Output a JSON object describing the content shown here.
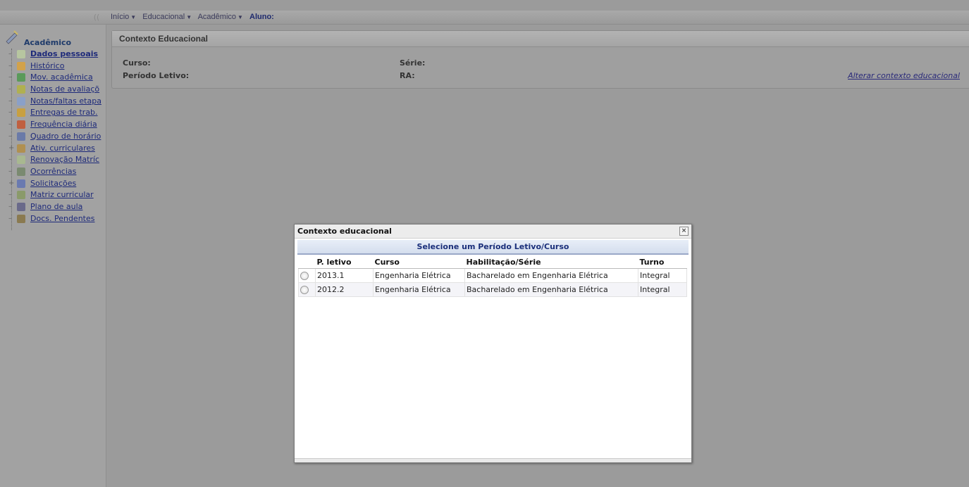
{
  "nav": {
    "collapse": "((",
    "crumbs": [
      {
        "label": "Início"
      },
      {
        "label": "Educacional"
      },
      {
        "label": "Acadêmico"
      }
    ],
    "aluno_label": "Aluno:"
  },
  "sidebar": {
    "title": "Acadêmico",
    "items": [
      {
        "label": "Dados pessoais",
        "icon": "bullet-icon",
        "color": "#b7c6a0"
      },
      {
        "label": "Histórico",
        "icon": "pencil-icon",
        "color": "#d2a24a"
      },
      {
        "label": "Mov. acadêmica",
        "icon": "arrows-icon",
        "color": "#5a9a5a"
      },
      {
        "label": "Notas de avaliaçõ",
        "icon": "bullet-icon",
        "color": "#b0b050"
      },
      {
        "label": "Notas/faltas etapa",
        "icon": "grid-icon",
        "color": "#8aa0c8"
      },
      {
        "label": "Entregas de trab.",
        "icon": "folder-icon",
        "color": "#c8a040"
      },
      {
        "label": "Frequência diária",
        "icon": "calendar-icon",
        "color": "#c06040"
      },
      {
        "label": "Quadro de horário",
        "icon": "clock-icon",
        "color": "#6a7aa8"
      },
      {
        "label": "Ativ. curriculares",
        "icon": "person-icon",
        "color": "#b09050"
      },
      {
        "label": "Renovação Matríc",
        "icon": "bullet-icon",
        "color": "#a8b890"
      },
      {
        "label": "Ocorrências",
        "icon": "pen-icon",
        "color": "#7a8a70"
      },
      {
        "label": "Solicitações",
        "icon": "form-icon",
        "color": "#6a7ab0"
      },
      {
        "label": "Matriz curricular",
        "icon": "check-icon",
        "color": "#8a9a6a"
      },
      {
        "label": "Plano de aula",
        "icon": "book-icon",
        "color": "#6a6a8a"
      },
      {
        "label": "Docs. Pendentes",
        "icon": "docs-icon",
        "color": "#8a7a50"
      }
    ]
  },
  "context": {
    "title": "Contexto Educacional",
    "curso_label": "Curso:",
    "serie_label": "Série:",
    "periodo_label": "Período Letivo:",
    "ra_label": "RA:",
    "change_link": "Alterar contexto educacional"
  },
  "modal": {
    "title": "Contexto educacional",
    "close": "×",
    "subtitle": "Selecione um Período Letivo/Curso",
    "columns": [
      "P. letivo",
      "Curso",
      "Habilitação/Série",
      "Turno"
    ],
    "rows": [
      {
        "periodo": "2013.1",
        "curso": "Engenharia Elétrica",
        "habilitacao": "Bacharelado em Engenharia Elétrica",
        "turno": "Integral"
      },
      {
        "periodo": "2012.2",
        "curso": "Engenharia Elétrica",
        "habilitacao": "Bacharelado em Engenharia Elétrica",
        "turno": "Integral"
      }
    ]
  }
}
